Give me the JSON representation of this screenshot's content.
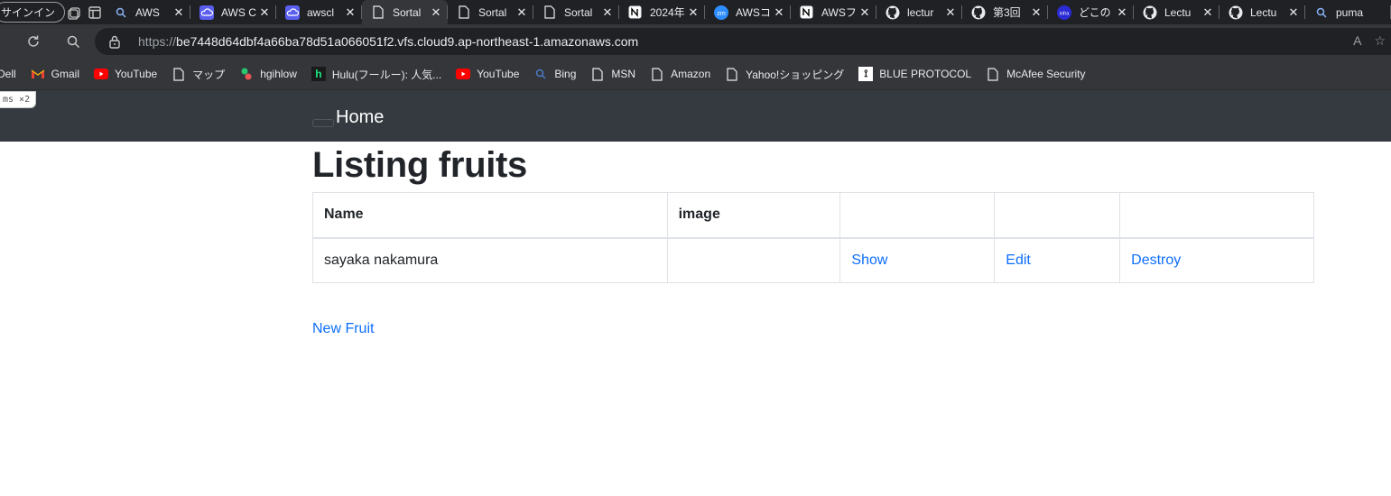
{
  "browser": {
    "signin_label": "サインイン",
    "tabs": [
      {
        "title": "AWS",
        "icon": "search-icon"
      },
      {
        "title": "AWS C",
        "icon": "cloud9-icon"
      },
      {
        "title": "awscl",
        "icon": "cloud9-icon"
      },
      {
        "title": "Sortal",
        "icon": "page-icon",
        "active": true
      },
      {
        "title": "Sortal",
        "icon": "page-icon"
      },
      {
        "title": "Sortal",
        "icon": "page-icon"
      },
      {
        "title": "2024年",
        "icon": "notion-icon"
      },
      {
        "title": "AWSコ",
        "icon": "zoom-icon"
      },
      {
        "title": "AWSフ",
        "icon": "notion-icon"
      },
      {
        "title": "lectur",
        "icon": "github-icon"
      },
      {
        "title": "第3回",
        "icon": "github-icon"
      },
      {
        "title": "どこの",
        "icon": "infra-icon"
      },
      {
        "title": "Lectu",
        "icon": "github-icon"
      },
      {
        "title": "Lectu",
        "icon": "github-icon"
      },
      {
        "title": "puma",
        "icon": "search-icon"
      }
    ],
    "address": {
      "scheme": "https://",
      "host": "be7448d64dbf4a66ba78d51a066051f2.vfs.cloud9.ap-northeast-1.amazonaws.com",
      "read_aloud": "A"
    },
    "bookmarks": [
      {
        "label": "Dell",
        "icon": "dell-icon"
      },
      {
        "label": "Gmail",
        "icon": "gmail-icon"
      },
      {
        "label": "YouTube",
        "icon": "youtube-icon"
      },
      {
        "label": "マップ",
        "icon": "page-icon"
      },
      {
        "label": "hgihlow",
        "icon": "hgihlow-icon"
      },
      {
        "label": "Hulu(フールー): 人気...",
        "icon": "hulu-icon"
      },
      {
        "label": "YouTube",
        "icon": "youtube-icon"
      },
      {
        "label": "Bing",
        "icon": "search-icon"
      },
      {
        "label": "MSN",
        "icon": "page-icon"
      },
      {
        "label": "Amazon",
        "icon": "page-icon"
      },
      {
        "label": "Yahoo!ショッピング",
        "icon": "page-icon"
      },
      {
        "label": "BLUE PROTOCOL",
        "icon": "blue-protocol-icon"
      },
      {
        "label": "McAfee Security",
        "icon": "page-icon"
      }
    ]
  },
  "app": {
    "dev_badge": "ms ×2",
    "nav_home": "Home",
    "title": "Listing fruits",
    "table": {
      "headers": [
        "Name",
        "image",
        "",
        "",
        ""
      ],
      "rows": [
        {
          "name": "sayaka nakamura",
          "image": "",
          "show": "Show",
          "edit": "Edit",
          "destroy": "Destroy"
        }
      ]
    },
    "new_link": "New Fruit"
  },
  "colors": {
    "navbar": "#343a40",
    "link": "#0d6efd",
    "browser_dark": "#202124",
    "toolbar": "#35363a"
  }
}
